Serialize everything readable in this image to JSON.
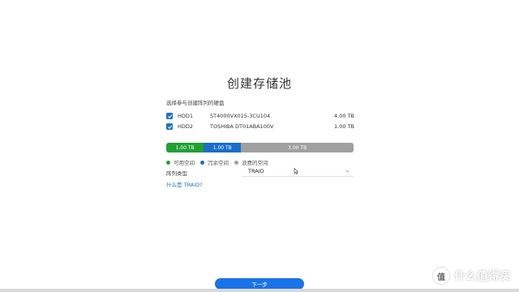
{
  "page": {
    "title": "创建存储池",
    "subtitle": "选择参与创建阵列的硬盘"
  },
  "disks": [
    {
      "name": "HDD1",
      "model": "ST4000VX015-3CU104",
      "size": "4.00 TB",
      "checked": true
    },
    {
      "name": "HDD2",
      "model": "TOSHIBA DT01ABA100V",
      "size": "1.00 TB",
      "checked": true
    }
  ],
  "capacity_bar": {
    "segments": [
      {
        "label": "1.00 TB",
        "color": "#22a033",
        "fraction": 0.2
      },
      {
        "label": "1.00 TB",
        "color": "#1a6fc9",
        "fraction": 0.2
      },
      {
        "label": "3.00 TB",
        "color": "#a0a0a0",
        "fraction": 0.6
      }
    ]
  },
  "legend": [
    {
      "label": "可用空间",
      "color": "#22a033"
    },
    {
      "label": "冗余空间",
      "color": "#1a6fc9"
    },
    {
      "label": "浪费的空间",
      "color": "#a0a0a0"
    }
  ],
  "raid": {
    "label": "阵列类型",
    "selected": "TRAID",
    "help_link": "什么是 TRAID?"
  },
  "actions": {
    "next": "下一步"
  },
  "watermark": {
    "text": "什么值得买",
    "icon": "值"
  },
  "colors": {
    "accent": "#1a73e8",
    "link": "#1a73c8"
  }
}
